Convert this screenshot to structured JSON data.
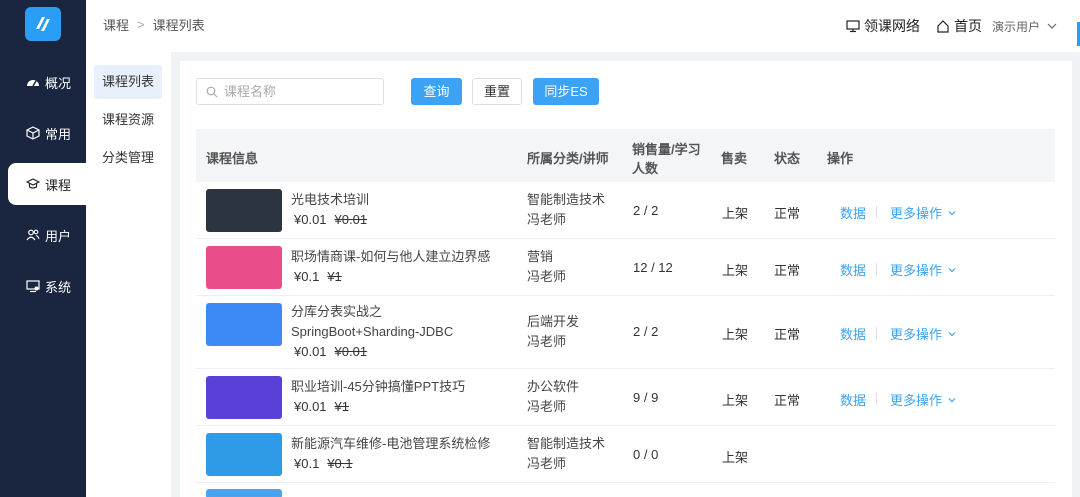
{
  "header": {
    "breadcrumb": [
      "课程",
      "课程列表"
    ],
    "network_label": "领课网络",
    "home_label": "首页",
    "user_label": "演示用户"
  },
  "nav": [
    {
      "label": "概况",
      "icon": "dashboard-icon"
    },
    {
      "label": "常用",
      "icon": "cube-icon"
    },
    {
      "label": "课程",
      "icon": "graduation-cap-icon",
      "active": true
    },
    {
      "label": "用户",
      "icon": "users-icon"
    },
    {
      "label": "系统",
      "icon": "monitor-icon"
    }
  ],
  "submenu": [
    {
      "label": "课程列表",
      "active": true
    },
    {
      "label": "课程资源"
    },
    {
      "label": "分类管理"
    }
  ],
  "search": {
    "placeholder": "课程名称"
  },
  "buttons": {
    "query": "查询",
    "reset": "重置",
    "sync": "同步ES"
  },
  "table": {
    "headers": {
      "info": "课程信息",
      "category": "所属分类/讲师",
      "sales_line1": "销售量/学习",
      "sales_line2": "人数",
      "sell": "售卖",
      "state": "状态",
      "ops": "操作"
    },
    "op_data": "数据",
    "op_more": "更多操作",
    "rows": [
      {
        "title": "光电技术培训",
        "price": "¥0.01",
        "old_price": "¥0.01",
        "category": "智能制造技术",
        "teacher": "冯老师",
        "sales": "2 / 2",
        "sell": "上架",
        "state": "正常",
        "thumb_color": "#2b3440"
      },
      {
        "title": "职场情商课-如何与他人建立边界感",
        "price": "¥0.1",
        "old_price": "¥1",
        "category": "营销",
        "teacher": "冯老师",
        "sales": "12 / 12",
        "sell": "上架",
        "state": "正常",
        "thumb_color": "#e94d8a"
      },
      {
        "title": "分库分表实战之SpringBoot+Sharding-JDBC",
        "price": "¥0.01",
        "old_price": "¥0.01",
        "category": "后端开发",
        "teacher": "冯老师",
        "sales": "2 / 2",
        "sell": "上架",
        "state": "正常",
        "thumb_color": "#3d8af7"
      },
      {
        "title": "职业培训-45分钟搞懂PPT技巧",
        "price": "¥0.01",
        "old_price": "¥1",
        "category": "办公软件",
        "teacher": "冯老师",
        "sales": "9 / 9",
        "sell": "上架",
        "state": "正常",
        "thumb_color": "#5a3fd8"
      },
      {
        "title": "新能源汽车维修-电池管理系统检修",
        "price": "¥0.1",
        "old_price": "¥0.1",
        "category": "智能制造技术",
        "teacher": "冯老师",
        "sales": "0 / 0",
        "sell": "上架",
        "state": "",
        "thumb_color": "#2f9be8"
      }
    ]
  }
}
